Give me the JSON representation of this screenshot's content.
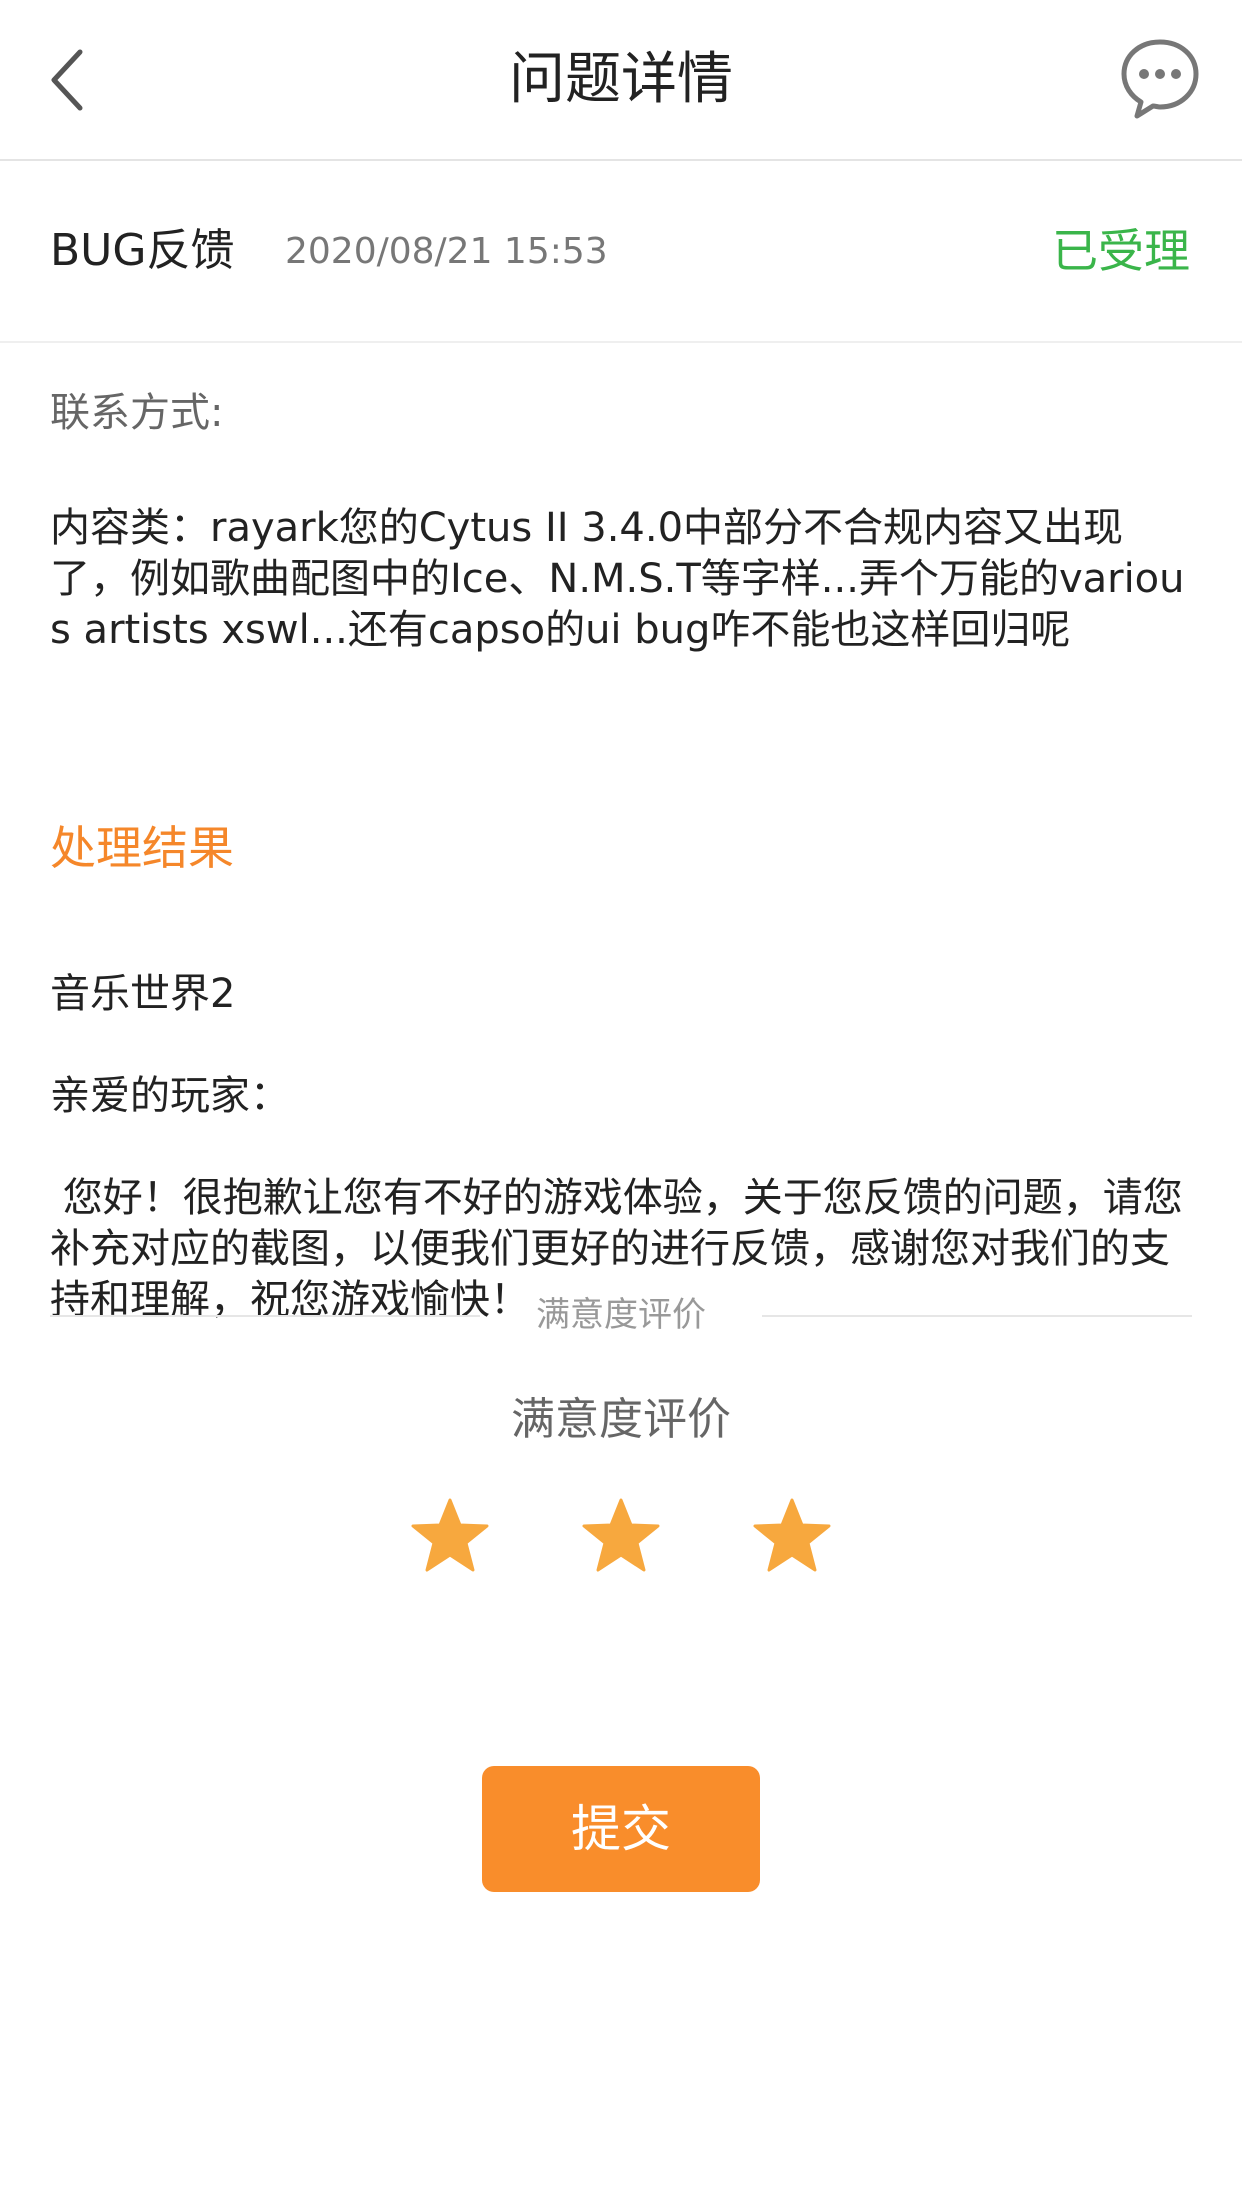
{
  "header": {
    "title": "问题详情",
    "back_icon": "chevron-left-icon",
    "chat_icon": "chat-bubble-icon"
  },
  "ticket": {
    "type": "BUG反馈",
    "timestamp": "2020/08/21 15:53",
    "status": "已受理",
    "status_color": "#3ab54a"
  },
  "details": {
    "contact_label": "联系方式:",
    "content": "内容类：rayark您的Cytus II 3.4.0中部分不合规内容又出现了，例如歌曲配图中的Ice、N.M.S.T等字样...弄个万能的various artists xswl...还有capso的ui bug咋不能也这样回归呢"
  },
  "result": {
    "title": "处理结果",
    "title_color": "#f5872a",
    "lines": [
      "音乐世界2",
      "亲爱的玩家：",
      " 您好！很抱歉让您有不好的游戏体验，关于您反馈的问题，请您补充对应的截图，以便我们更好的进行反馈，感谢您对我们的支持和理解，祝您游戏愉快！"
    ]
  },
  "rating": {
    "divider_label": "满意度评价",
    "title": "满意度评价",
    "stars_total": 3,
    "stars_selected": 3,
    "star_color": "#f7a83e",
    "star_icon": "star-icon"
  },
  "submit": {
    "label": "提交",
    "color": "#f98d2b"
  }
}
